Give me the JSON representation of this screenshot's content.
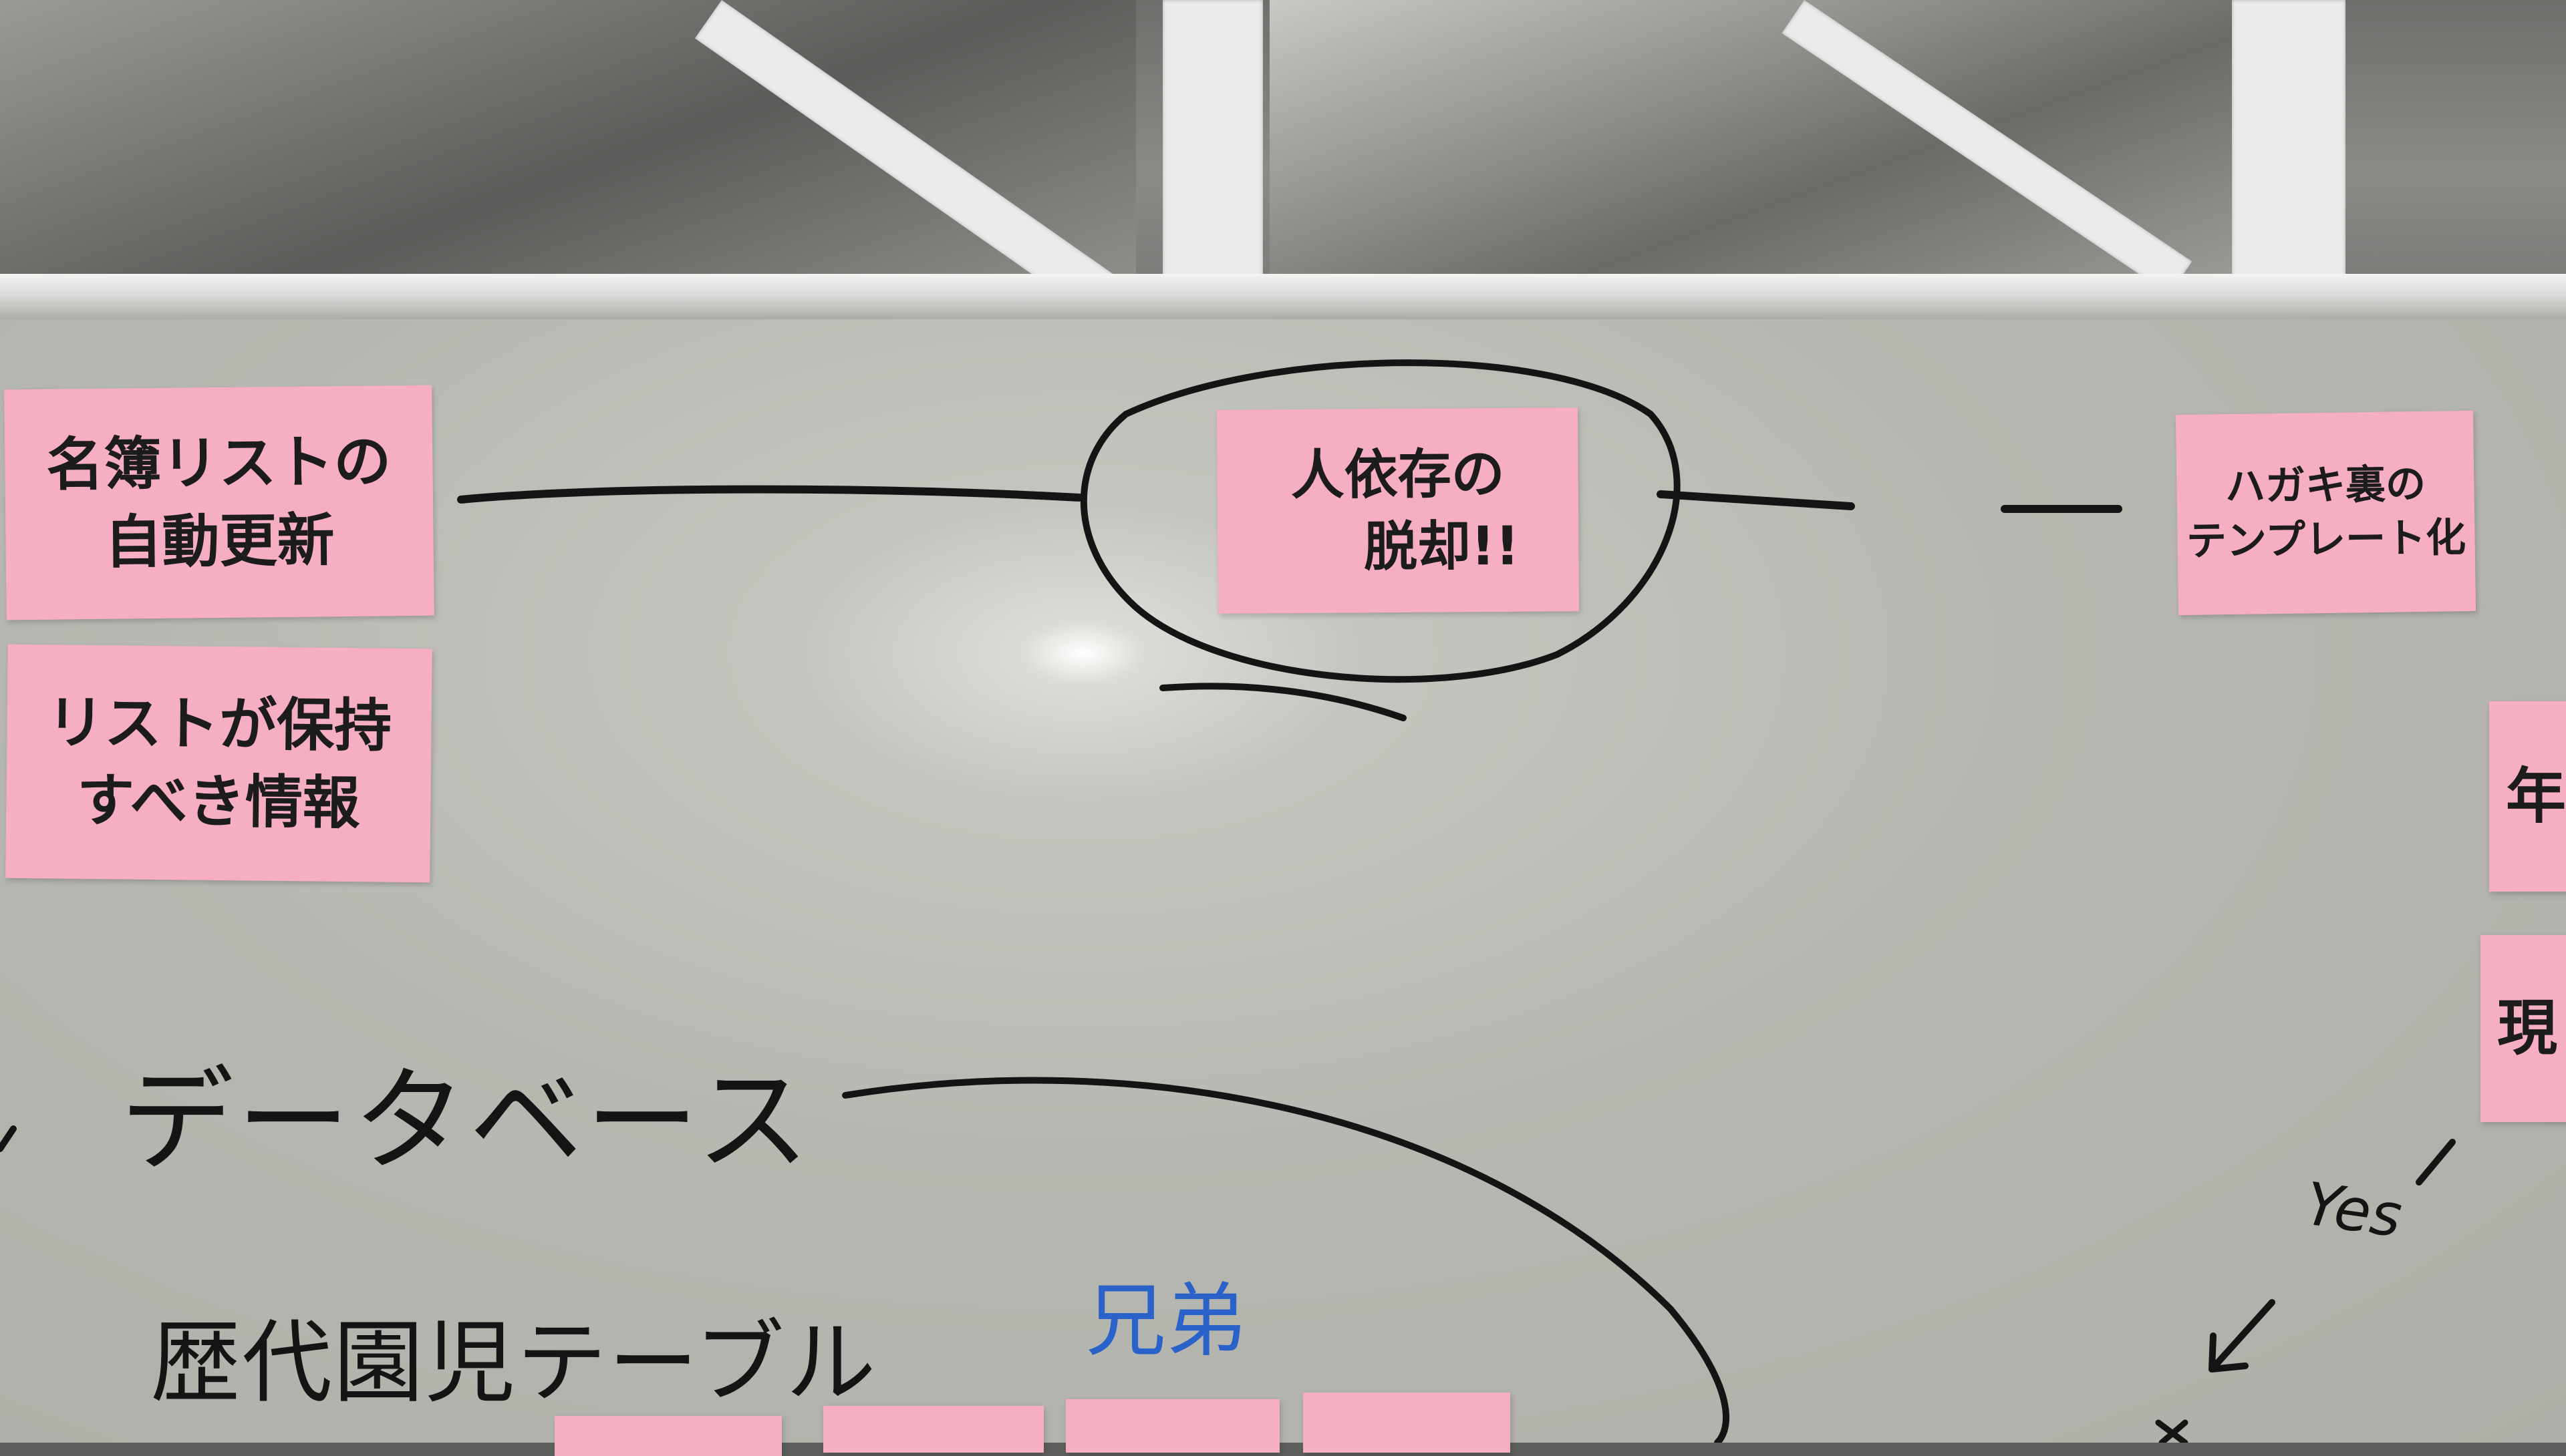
{
  "notes": {
    "meibo_auto_update": {
      "line1": "名簿リストの",
      "line2": "自動更新"
    },
    "list_info": {
      "line1": "リストが保持",
      "line2": "すべき情報"
    },
    "escape_dependency": {
      "line1": "人依存の",
      "line2": "脱却!!"
    },
    "postcard_template": {
      "line1": "ハガキ裏の",
      "line2": "テンプレート化"
    },
    "edge_note_1": {
      "line1": "年"
    },
    "edge_note_2": {
      "line1": "現"
    }
  },
  "board_text": {
    "database": "データベース",
    "table": "歴代園児テーブル",
    "siblings": "兄弟",
    "yes": "Yes"
  },
  "colors": {
    "note_pink": "#f6aec3",
    "marker_black": "#141414",
    "marker_blue": "#2a62c9",
    "board": "#c4c5be"
  }
}
